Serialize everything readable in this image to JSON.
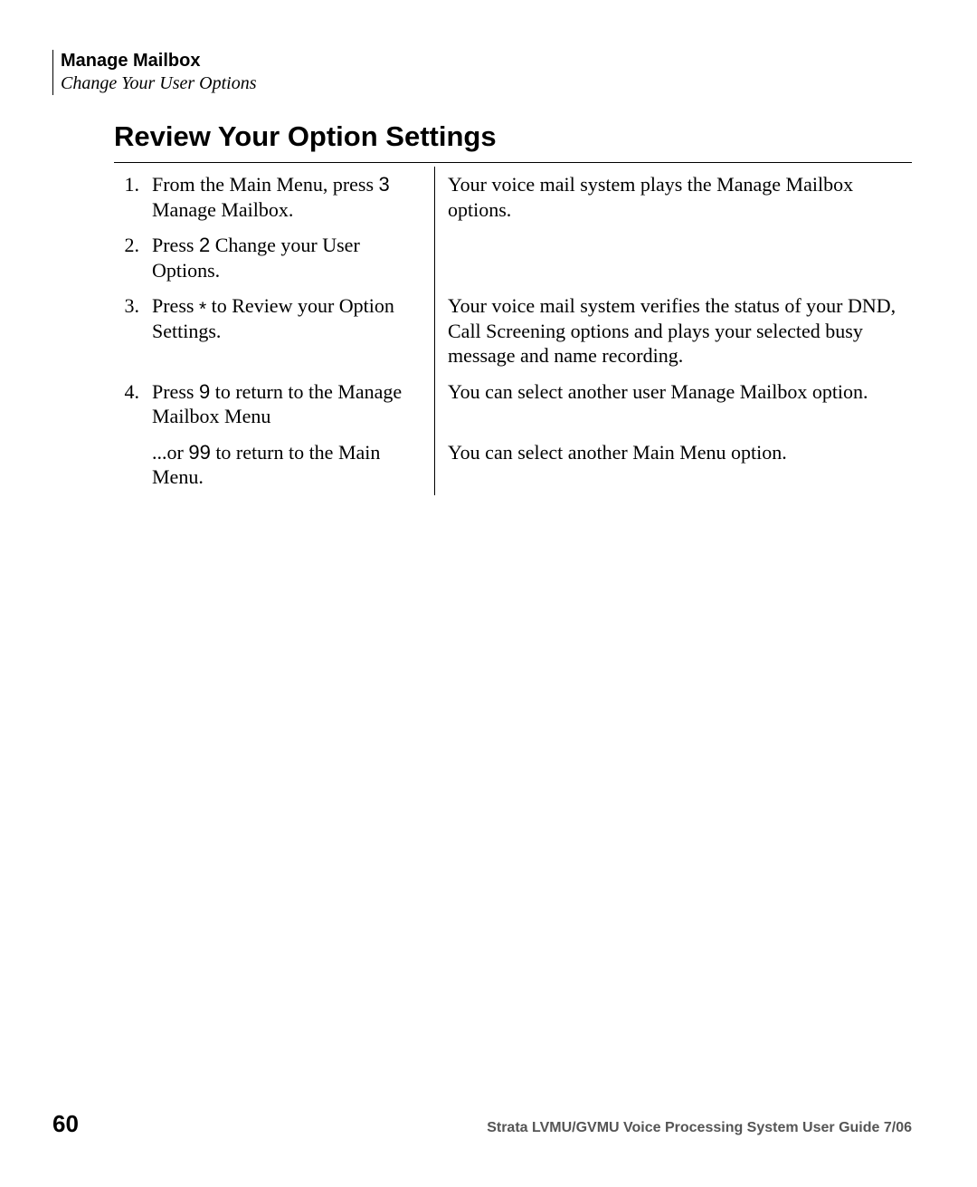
{
  "header": {
    "title": "Manage Mailbox",
    "subtitle": "Change Your User Options"
  },
  "section_title": "Review Your Option Settings",
  "steps": [
    {
      "num": "1.",
      "instr_pre": "From the Main Menu, press ",
      "key": "3",
      "instr_post": " Manage Mailbox.",
      "result": "Your voice mail system plays the Manage Mailbox options."
    },
    {
      "num": "2.",
      "instr_pre": "Press ",
      "key": "2",
      "instr_post": " Change your User Options.",
      "result": ""
    },
    {
      "num": "3.",
      "instr_pre": "Press ",
      "key": "*",
      "instr_post": " to Review your Option Settings.",
      "result": "Your voice mail system verifies the status of your DND, Call Screening options and plays your selected busy message and name recording."
    },
    {
      "num": "4.",
      "instr_pre": "Press ",
      "key": "9",
      "instr_post": " to return to the Manage Mailbox Menu",
      "result": "You can select another user Manage Mailbox option."
    }
  ],
  "substep": {
    "instr_pre": "...or ",
    "key": "99",
    "instr_post": " to return to the Main Menu.",
    "result": "You can select another Main Menu option."
  },
  "footer": {
    "page": "60",
    "text": "Strata LVMU/GVMU Voice Processing System User Guide    7/06"
  }
}
